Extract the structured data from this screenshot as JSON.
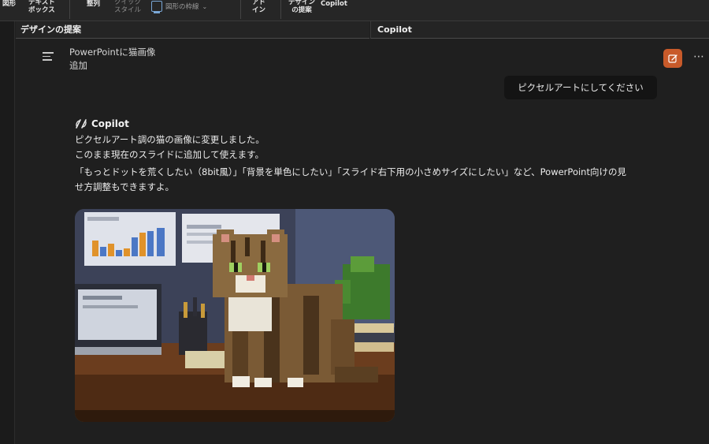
{
  "ribbon": {
    "shapes": "図形",
    "textbox": "テキスト\nボックス",
    "arrange": "整列",
    "quick_style": "クイック\nスタイル",
    "shape_outline": "図形の枠線",
    "addins": "アド\nイン",
    "design_ideas": "デザイン\nの提案",
    "copilot": "Copilot"
  },
  "panes": {
    "design_title": "デザインの提案",
    "copilot_title": "Copilot"
  },
  "conversation": {
    "title": "PowerPointに猫画像追加",
    "user_message": "ピクセルアートにしてください",
    "bot_name": "Copilot",
    "bot_lines": [
      "ピクセルアート調の猫の画像に変更しました。",
      "このまま現在のスライドに追加して使えます。",
      "「もっとドットを荒くしたい（8bit風）」「背景を単色にしたい」「スライド右下用の小さめサイズにしたい」など、PowerPoint向けの見せ方調整もできますよ。"
    ]
  },
  "icons": {
    "menu": "hamburger-menu-icon",
    "new_chat": "new-chat-edit-icon",
    "more": "more-options-icon",
    "copilot": "copilot-logo-icon",
    "chevron": "chevron-down-icon"
  },
  "colors": {
    "accent": "#c85a2a",
    "background": "#1f1f1f",
    "bubble": "#141414"
  }
}
